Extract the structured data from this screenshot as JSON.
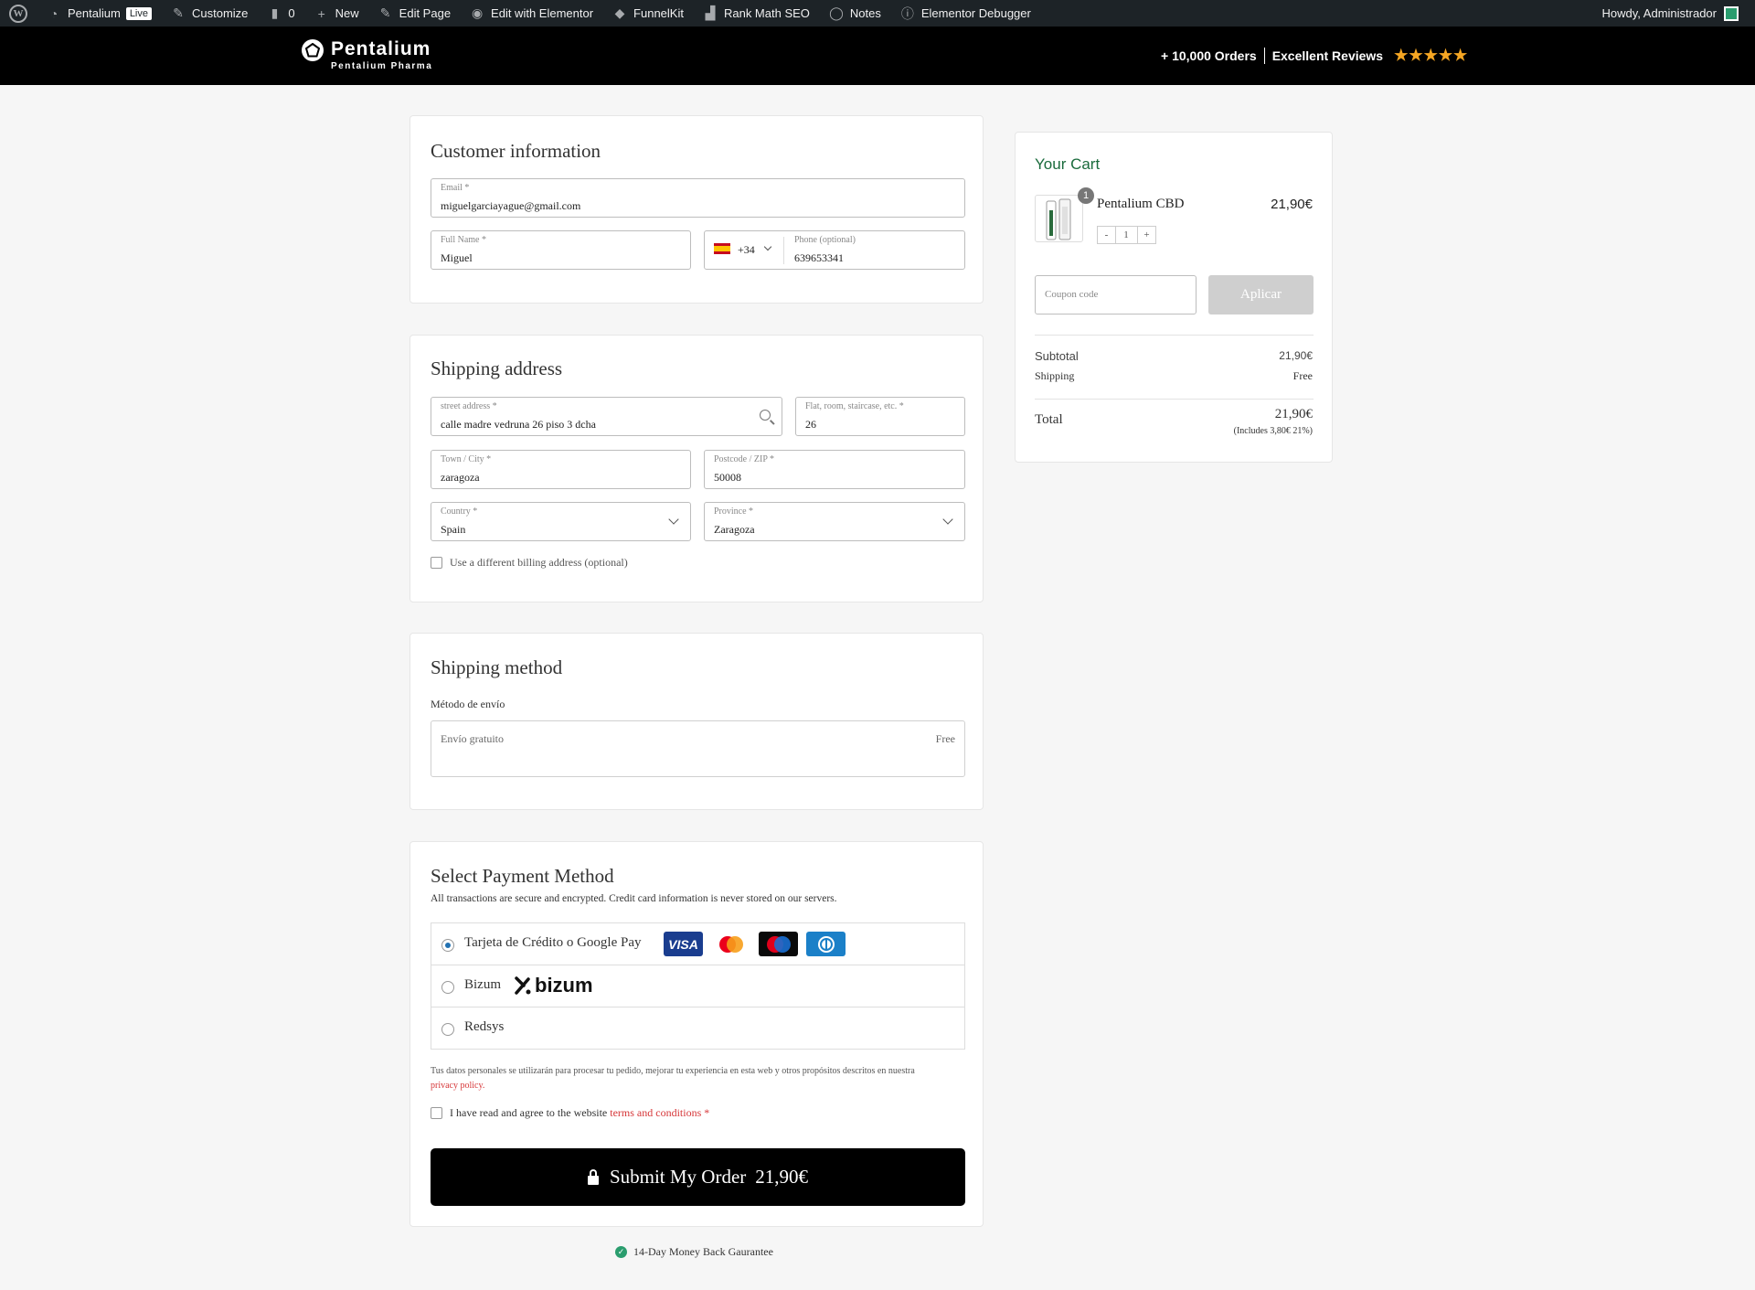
{
  "adminbar": {
    "site": "Pentalium",
    "live": "Live",
    "customize": "Customize",
    "comments": "0",
    "new": "New",
    "edit_page": "Edit Page",
    "edit_elementor": "Edit with Elementor",
    "funnelkit": "FunnelKit",
    "rankmath": "Rank Math SEO",
    "notes": "Notes",
    "debugger": "Elementor Debugger",
    "howdy": "Howdy, Administrador"
  },
  "header": {
    "brand": "Pentalium",
    "brand_sub": "Pentalium Pharma",
    "orders": "+ 10,000 Orders",
    "reviews": "Excellent Reviews",
    "stars": "★★★★★"
  },
  "customer": {
    "title": "Customer information",
    "email_label": "Email *",
    "email_value": "miguelgarciayague@gmail.com",
    "name_label": "Full Name *",
    "name_value": "Miguel",
    "country_code": "+34",
    "phone_label": "Phone (optional)",
    "phone_value": "639653341"
  },
  "shipping_address": {
    "title": "Shipping address",
    "street_label": "street address *",
    "street_value": "calle madre vedruna 26 piso 3 dcha",
    "flat_label": "Flat, room, staircase, etc. *",
    "flat_value": "26",
    "city_label": "Town / City *",
    "city_value": "zaragoza",
    "zip_label": "Postcode / ZIP *",
    "zip_value": "50008",
    "country_label": "Country *",
    "country_value": "Spain",
    "province_label": "Province *",
    "province_value": "Zaragoza",
    "billing_check": "Use a different billing address (optional)"
  },
  "shipping_method": {
    "title": "Shipping method",
    "subtitle": "Método de envío",
    "option": "Envío gratuito",
    "price": "Free"
  },
  "payment": {
    "title": "Select Payment Method",
    "subtitle": "All transactions are secure and encrypted. Credit card information is never stored on our servers.",
    "methods": [
      {
        "label": "Tarjeta de Crédito o Google Pay",
        "selected": true
      },
      {
        "label": "Bizum",
        "selected": false
      },
      {
        "label": "Redsys",
        "selected": false
      }
    ],
    "card_logos": {
      "visa": "VISA",
      "maestro": "Maestro",
      "bizum": "bizum"
    },
    "privacy_text": "Tus datos personales se utilizarán para procesar tu pedido, mejorar tu experiencia en esta web y otros propósitos descritos en nuestra",
    "privacy_link": "privacy policy.",
    "terms_text": "I have read and agree to the website",
    "terms_link": "terms and conditions",
    "terms_required": "*",
    "submit_label": "Submit My Order",
    "submit_total": "21,90€",
    "guarantee": "14-Day Money Back Gaurantee"
  },
  "cart": {
    "title": "Your Cart",
    "item_name": "Pentalium CBD",
    "item_price": "21,90€",
    "item_count": "1",
    "qty_minus": "-",
    "qty_value": "1",
    "qty_plus": "+",
    "coupon_placeholder": "Coupon code",
    "coupon_button": "Aplicar",
    "subtotal_label": "Subtotal",
    "subtotal_value": "21,90€",
    "shipping_label": "Shipping",
    "shipping_value": "Free",
    "total_label": "Total",
    "total_value": "21,90€",
    "tax_note": "(Includes 3,80€ 21%)"
  },
  "colors": {
    "accent_green": "#1a6b3c",
    "link_red": "#d63638",
    "radio_blue": "#2271b1"
  }
}
